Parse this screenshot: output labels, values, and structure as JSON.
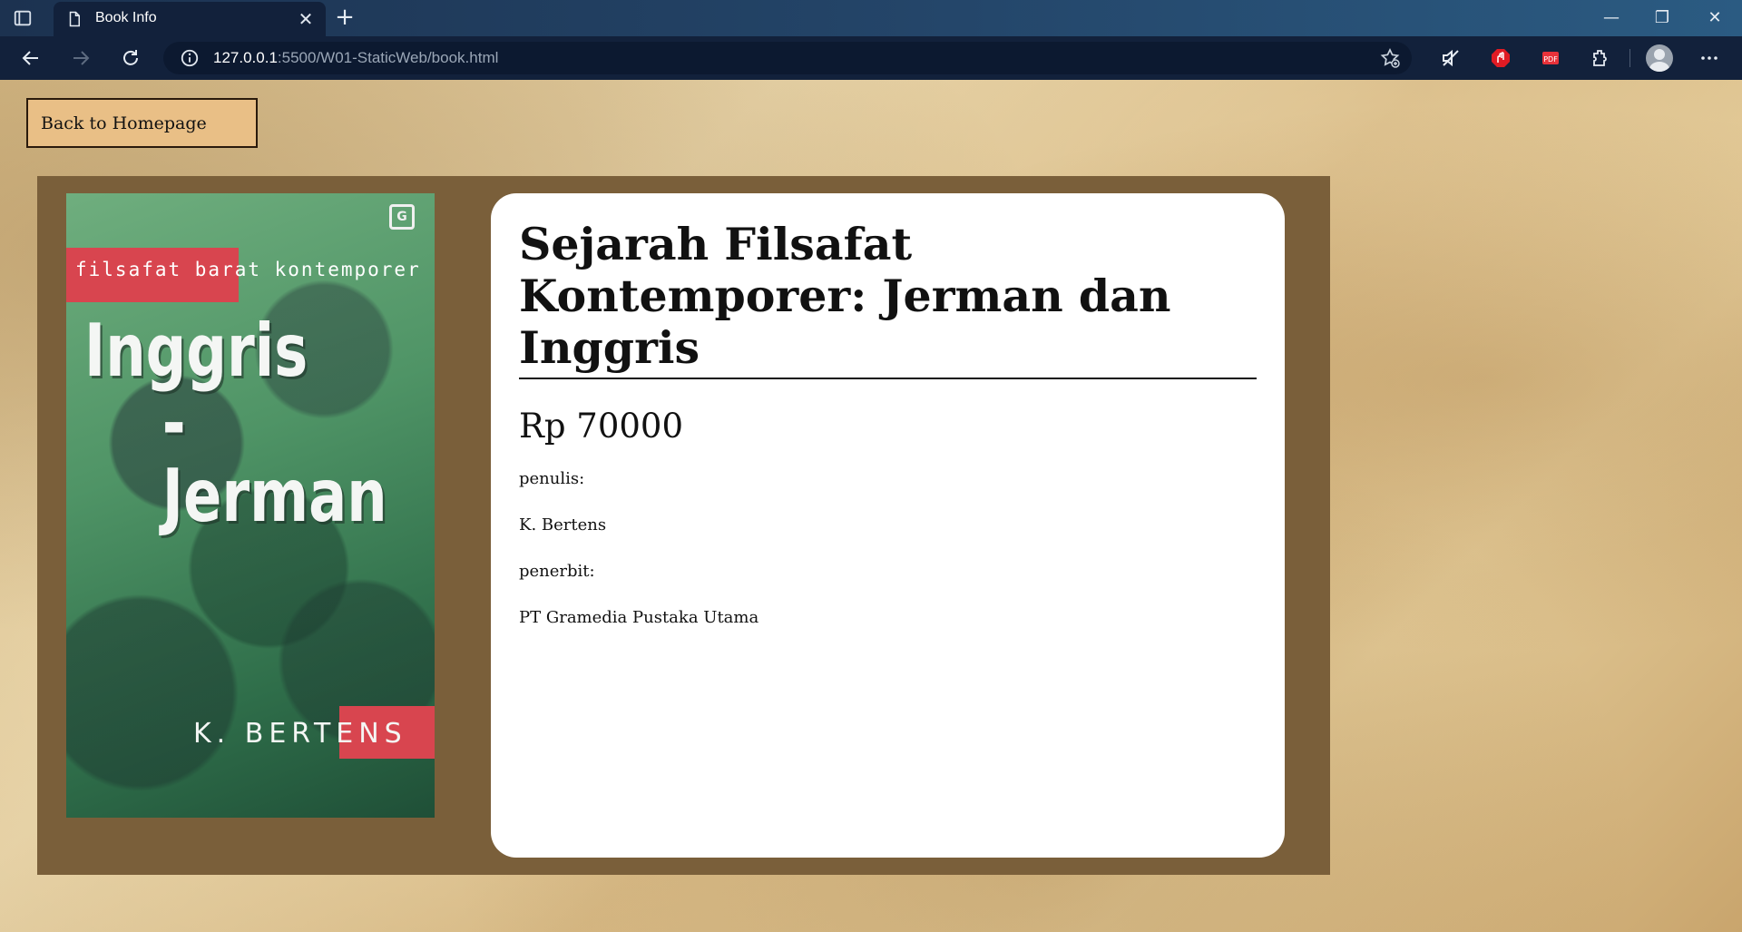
{
  "browser": {
    "tab_title": "Book Info",
    "url_host": "127.0.0.1",
    "url_rest": ":5500/W01-StaticWeb/book.html",
    "icons": [
      "tab-actions-icon",
      "page-icon",
      "close-icon",
      "plus-icon",
      "back-icon",
      "forward-icon",
      "refresh-icon",
      "info-icon",
      "favorites-icon",
      "read-aloud-icon",
      "adblock-icon",
      "pdf-icon",
      "extensions-icon",
      "profile-avatar",
      "more-icon",
      "minimize-icon",
      "restore-icon",
      "window-close-icon"
    ]
  },
  "page": {
    "back_button": "Back to Homepage",
    "book": {
      "title": "Sejarah Filsafat Kontemporer: Jerman dan Inggris",
      "price": "Rp 70000",
      "author_label": "penulis:",
      "author": "K. Bertens",
      "publisher_label": "penerbit:",
      "publisher": "PT Gramedia Pustaka Utama"
    },
    "cover": {
      "series": "filsafat barat kontemporer",
      "title_line1": "Inggris",
      "title_line2": "-Jerman",
      "author": "K. BERTENS",
      "logo": "G"
    }
  },
  "colors": {
    "card_bg": "#7a5f3a",
    "button_bg": "#e9bf86",
    "cover_accent": "#d8454f"
  }
}
